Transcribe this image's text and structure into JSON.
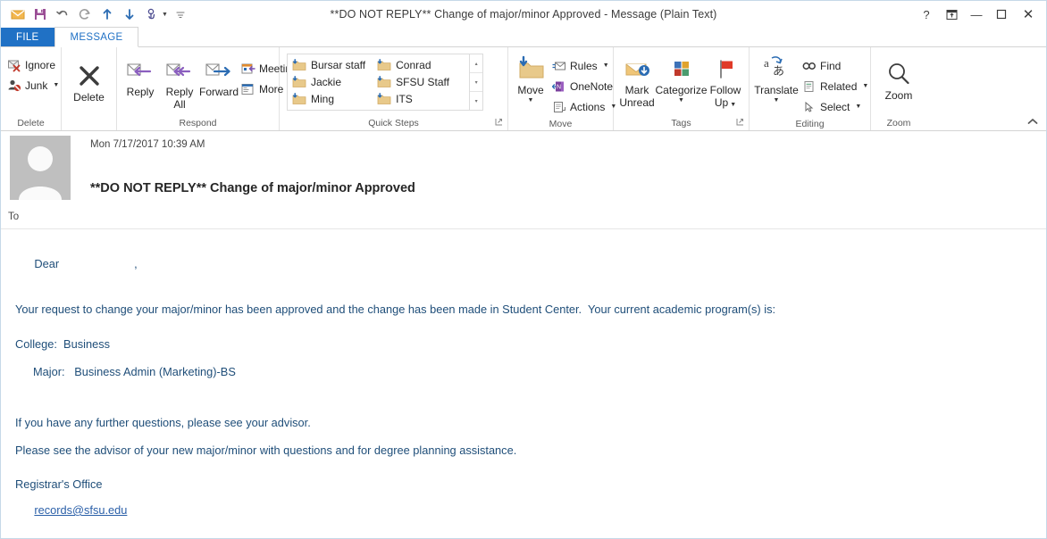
{
  "window": {
    "title": "**DO NOT REPLY**  Change of major/minor Approved - Message (Plain Text)",
    "help_label": "?",
    "ribbon_options_label": "⤒",
    "minimize_label": "—",
    "maximize_label": "☐",
    "close_label": "✕",
    "collapse_ribbon_label": "▲"
  },
  "quick_access": {
    "items": [
      {
        "name": "mail-icon",
        "label": "Mail"
      },
      {
        "name": "save-icon",
        "label": "Save"
      },
      {
        "name": "undo-icon",
        "label": "Undo"
      },
      {
        "name": "redo-icon",
        "label": "Redo"
      },
      {
        "name": "previous-item-icon",
        "label": "Previous Item"
      },
      {
        "name": "next-item-icon",
        "label": "Next Item"
      },
      {
        "name": "touch-mode-icon",
        "label": "Touch/Mouse Mode"
      },
      {
        "name": "customize-qat-icon",
        "label": "Customize Quick Access Toolbar"
      }
    ]
  },
  "tabs": {
    "file": "FILE",
    "message": "MESSAGE"
  },
  "ribbon": {
    "groups": {
      "delete": {
        "label": "Delete",
        "ignore": "Ignore",
        "junk": "Junk",
        "delete": "Delete"
      },
      "respond": {
        "label": "Respond",
        "reply": "Reply",
        "reply_all": "Reply\nAll",
        "reply_all_line1": "Reply",
        "reply_all_line2": "All",
        "forward": "Forward",
        "meeting": "Meeting",
        "more": "More"
      },
      "quick_steps": {
        "label": "Quick Steps",
        "items_col1": [
          "Bursar staff",
          "Jackie",
          "Ming"
        ],
        "items_col2": [
          "Conrad",
          "SFSU Staff",
          "ITS"
        ],
        "scroll_up": "▴",
        "scroll_down": "▾",
        "more": "▾",
        "dialog_launcher": "⤡"
      },
      "move": {
        "label": "Move",
        "move": "Move",
        "rules": "Rules",
        "onenote": "OneNote",
        "actions": "Actions"
      },
      "tags": {
        "label": "Tags",
        "mark_unread_line1": "Mark",
        "mark_unread_line2": "Unread",
        "categorize": "Categorize",
        "follow_up_line1": "Follow",
        "follow_up_line2": "Up",
        "dialog_launcher": "⤡"
      },
      "editing": {
        "label": "Editing",
        "translate": "Translate",
        "find": "Find",
        "related": "Related",
        "select": "Select"
      },
      "zoom": {
        "label": "Zoom",
        "zoom": "Zoom"
      }
    }
  },
  "message": {
    "date": "Mon 7/17/2017 10:39 AM",
    "subject": "**DO NOT REPLY**  Change of major/minor Approved",
    "to_label": "To",
    "to_value": "",
    "body": {
      "greeting": "Dear",
      "greeting_comma": ",",
      "para1": "Your request to change your major/minor has been approved and the change has been made in Student Center.  Your current academic program(s) is:",
      "college": "College:  Business",
      "major": "Major:   Business Admin (Marketing)-BS",
      "para2": "If you have any further questions, please see your advisor.",
      "para3": "Please see the advisor of your new major/minor with questions and for degree planning assistance.",
      "sig_office": "Registrar's Office",
      "sig_email": "records@sfsu.edu"
    }
  },
  "colors": {
    "accent_blue": "#2071c5",
    "body_text_blue": "#1f4e79",
    "link_blue": "#2a5fa8",
    "folder_tan": "#e8c98a"
  }
}
